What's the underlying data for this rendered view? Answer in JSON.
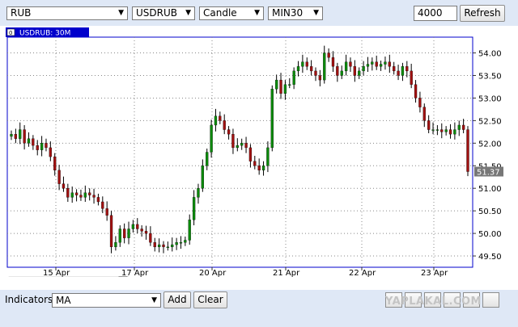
{
  "toolbar": {
    "currency": "RUB",
    "symbol": "USDRUB",
    "chart_type": "Candle",
    "timeframe": "MIN30",
    "bars_count": "4000",
    "refresh_label": "Refresh"
  },
  "chart": {
    "legend_label": "USDRUB: 30M",
    "legend_box_label": "0",
    "last_price_label": "51.37",
    "y_ticks": [
      "54.00",
      "53.50",
      "53.00",
      "52.50",
      "52.00",
      "51.50",
      "51.00",
      "50.50",
      "50.00",
      "49.50"
    ],
    "x_ticks": [
      "15 Apr",
      "17 Apr",
      "20 Apr",
      "21 Apr",
      "22 Apr",
      "23 Apr"
    ],
    "colors": {
      "up": "#0b8a0b",
      "down": "#a01010",
      "frame": "#0000cc",
      "grid": "#888888"
    }
  },
  "bottom": {
    "indicators_label": "Indicators",
    "indicator_value": "MA",
    "add_label": "Add",
    "clear_label": "Clear",
    "watermark": "YAPLAKAL.COM"
  },
  "chart_data": {
    "type": "candlestick",
    "title": "USDRUB: 30M",
    "ylim": [
      49.25,
      54.35
    ],
    "x_labels": [
      "15 Apr",
      "17 Apr",
      "20 Apr",
      "21 Apr",
      "22 Apr",
      "23 Apr"
    ],
    "last": 51.37,
    "closes": [
      52.2,
      52.1,
      52.3,
      52.0,
      52.1,
      51.95,
      51.85,
      52.0,
      51.9,
      51.7,
      51.4,
      51.1,
      51.0,
      50.8,
      50.9,
      50.85,
      50.8,
      50.9,
      50.85,
      50.8,
      50.7,
      50.55,
      50.4,
      49.7,
      49.8,
      50.1,
      49.9,
      50.1,
      50.2,
      50.1,
      50.05,
      50.0,
      49.8,
      49.7,
      49.75,
      49.7,
      49.7,
      49.75,
      49.8,
      49.8,
      49.85,
      50.3,
      50.8,
      51.0,
      51.5,
      51.8,
      52.4,
      52.6,
      52.5,
      52.3,
      52.2,
      51.9,
      51.95,
      52.0,
      51.9,
      51.6,
      51.5,
      51.4,
      51.5,
      51.9,
      53.2,
      53.4,
      53.1,
      53.3,
      53.3,
      53.6,
      53.7,
      53.8,
      53.7,
      53.6,
      53.5,
      53.4,
      54.0,
      53.9,
      53.7,
      53.5,
      53.6,
      53.8,
      53.7,
      53.5,
      53.6,
      53.7,
      53.75,
      53.8,
      53.7,
      53.75,
      53.8,
      53.7,
      53.6,
      53.5,
      53.7,
      53.6,
      53.3,
      53.0,
      52.8,
      52.5,
      52.3,
      52.3,
      52.3,
      52.25,
      52.3,
      52.2,
      52.3,
      52.4,
      52.3,
      51.37
    ]
  }
}
